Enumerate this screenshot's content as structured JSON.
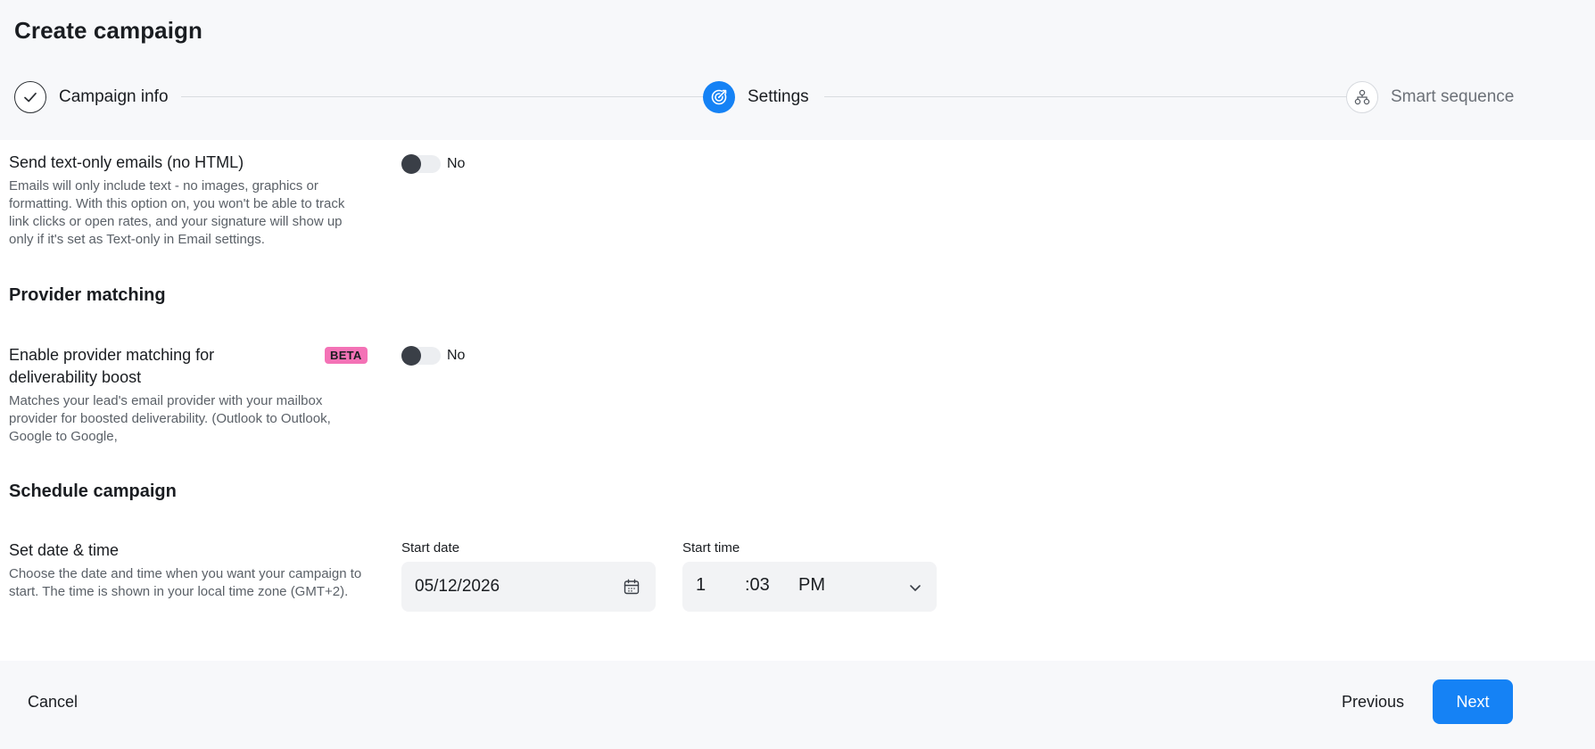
{
  "page": {
    "title": "Create campaign"
  },
  "stepper": {
    "steps": [
      {
        "label": "Campaign info",
        "state": "completed",
        "icon": "check-icon"
      },
      {
        "label": "Settings",
        "state": "active",
        "icon": "target-icon"
      },
      {
        "label": "Smart sequence",
        "state": "pending",
        "icon": "sequence-icon"
      }
    ]
  },
  "text_only": {
    "title": "Send text-only emails (no HTML)",
    "description": "Emails will only include text - no images, graphics or formatting. With this option on, you won't be able to track link clicks or open rates, and your signature will show up only if it's set as Text-only in Email settings.",
    "toggle_label": "No",
    "enabled": false
  },
  "provider_matching": {
    "heading": "Provider matching",
    "title": "Enable provider matching for deliverability boost",
    "badge": "BETA",
    "description": "Matches your lead's email provider with your mailbox provider for boosted deliverability. (Outlook to Outlook, Google to Google,",
    "toggle_label": "No",
    "enabled": false
  },
  "schedule": {
    "heading": "Schedule campaign",
    "title": "Set date & time",
    "description": "Choose the date and time when you want your campaign to start. The time is shown in your local time zone (GMT+2).",
    "start_date_label": "Start date",
    "start_date_value": "05/12/2026",
    "start_time_label": "Start time",
    "time_hour": "1",
    "time_minute": ":03",
    "time_period": "PM"
  },
  "footer": {
    "cancel_label": "Cancel",
    "previous_label": "Previous",
    "next_label": "Next"
  },
  "colors": {
    "accent": "#1582f5",
    "beta_badge": "#f472b6",
    "header_bg": "#f7f8fa"
  }
}
